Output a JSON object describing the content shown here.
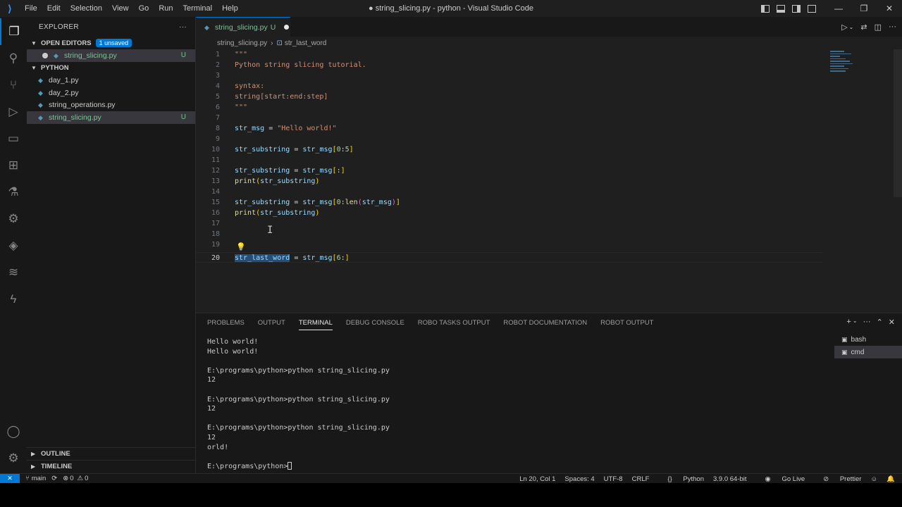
{
  "window": {
    "title": "● string_slicing.py - python - Visual Studio Code",
    "menu": [
      "File",
      "Edit",
      "Selection",
      "View",
      "Go",
      "Run",
      "Terminal",
      "Help"
    ]
  },
  "sidebar": {
    "title": "EXPLORER",
    "open_editors": {
      "label": "OPEN EDITORS",
      "badge": "1 unsaved"
    },
    "open_files": [
      {
        "name": "string_slicing.py",
        "mark": "U"
      }
    ],
    "folder": {
      "label": "PYTHON"
    },
    "files": [
      {
        "name": "day_1.py",
        "mark": ""
      },
      {
        "name": "day_2.py",
        "mark": ""
      },
      {
        "name": "string_operations.py",
        "mark": ""
      },
      {
        "name": "string_slicing.py",
        "mark": "U"
      }
    ],
    "outline": "OUTLINE",
    "timeline": "TIMELINE"
  },
  "tab": {
    "label": "string_slicing.py",
    "mark": "U"
  },
  "breadcrumb": {
    "file": "string_slicing.py",
    "symbol": "str_last_word"
  },
  "code_lines": [
    "\"\"\"",
    "Python string slicing tutorial.",
    "",
    "syntax:",
    "string[start:end:step]",
    "\"\"\"",
    "",
    "str_msg = \"Hello world!\"",
    "",
    "str_substring = str_msg[0:5]",
    "",
    "str_substring = str_msg[:]",
    "print(str_substring)",
    "",
    "str_substring = str_msg[0:len(str_msg)]",
    "print(str_substring)",
    "",
    "",
    "",
    "str_last_word = str_msg[6:]"
  ],
  "panel": {
    "tabs": [
      "PROBLEMS",
      "OUTPUT",
      "TERMINAL",
      "DEBUG CONSOLE",
      "ROBO TASKS OUTPUT",
      "ROBOT DOCUMENTATION",
      "ROBOT OUTPUT"
    ],
    "active_tab": "TERMINAL",
    "terminal_text": "Hello world!\nHello world!\n\nE:\\programs\\python>python string_slicing.py\n12\n\nE:\\programs\\python>python string_slicing.py\n12\n\nE:\\programs\\python>python string_slicing.py\n12\norld!\n\nE:\\programs\\python>",
    "terminals": [
      "bash",
      "cmd"
    ]
  },
  "status": {
    "branch": "main",
    "errors": "0",
    "warnings": "0",
    "position": "Ln 20, Col 1",
    "spaces": "Spaces: 4",
    "encoding": "UTF-8",
    "eol": "CRLF",
    "language": "Python",
    "interpreter": "3.9.0 64-bit",
    "golive": "Go Live",
    "prettier": "Prettier"
  },
  "colors": {
    "accent": "#0078d4",
    "modified": "#73c991",
    "string": "#ce9178",
    "variable": "#9cdcfe"
  }
}
